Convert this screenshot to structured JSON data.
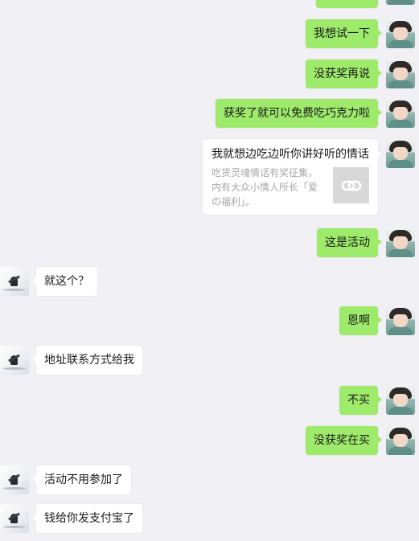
{
  "messages": [
    {
      "side": "out",
      "text": ""
    },
    {
      "side": "out",
      "text": "我想试一下"
    },
    {
      "side": "out",
      "text": "没获奖再说"
    },
    {
      "side": "out",
      "text": "获奖了就可以免费吃巧克力啦"
    },
    {
      "side": "out",
      "type": "link",
      "title": "我就想边吃边听你讲好听的情话",
      "description": "吃货灵魂情话有奖征集，内有大众小情人所长「爱の福利」。",
      "thumb_icon": "link-icon"
    },
    {
      "side": "out",
      "text": "这是活动"
    },
    {
      "side": "in",
      "text": "就这个？"
    },
    {
      "side": "out",
      "text": "恩啊"
    },
    {
      "side": "in",
      "text": "地址联系方式给我"
    },
    {
      "side": "out",
      "text": "不买"
    },
    {
      "side": "out",
      "text": "没获奖在买"
    },
    {
      "side": "in",
      "text": "活动不用参加了"
    },
    {
      "side": "in",
      "text": "钱给你发支付宝了"
    }
  ],
  "colors": {
    "background": "#f1f0f5",
    "outgoing_bubble": "#9eea6a",
    "incoming_bubble": "#ffffff"
  }
}
